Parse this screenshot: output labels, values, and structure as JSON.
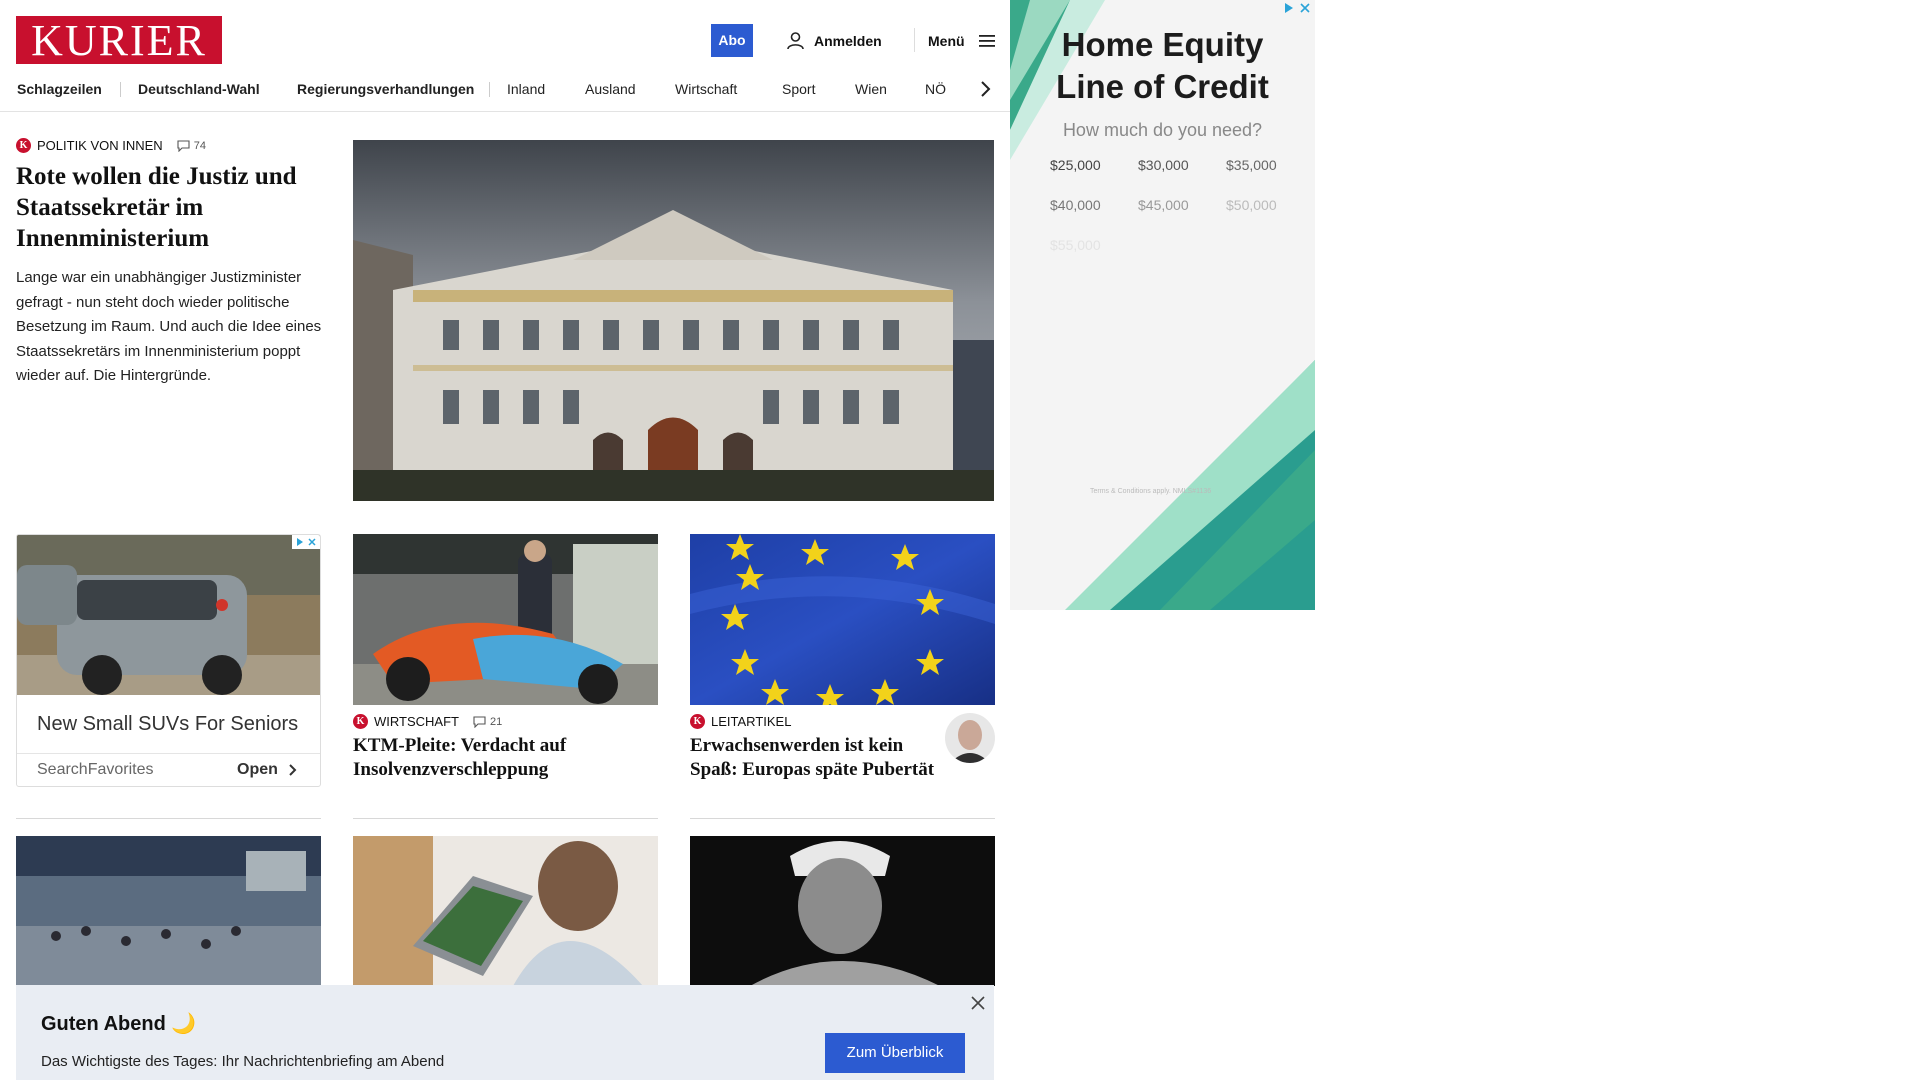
{
  "header": {
    "logo": "KURIER",
    "abo_label": "Abo",
    "login_label": "Anmelden",
    "menu_label": "Menü"
  },
  "nav": {
    "items": [
      "Schlagzeilen",
      "Deutschland-Wahl",
      "Regierungsverhandlungen",
      "Inland",
      "Ausland",
      "Wirtschaft",
      "Sport",
      "Wien",
      "NÖ"
    ]
  },
  "lead": {
    "category": "Politik von innen",
    "comments": "74",
    "title": "Rote wollen die Justiz und Staatssekretär im Innenministerium",
    "teaser": "Lange war ein unabhängiger Justizminister gefragt - nun steht doch wieder politische Besetzung im Raum. Und auch die Idee eines Staatssekretärs im Innenministerium poppt wieder auf. Die Hintergründe."
  },
  "inline_ad": {
    "title": "New Small SUVs For Seniors",
    "source": "SearchFavorites",
    "open_label": "Open"
  },
  "cards": [
    {
      "category": "Wirtschaft",
      "comments": "21",
      "title": "KTM-Pleite: Verdacht auf Insolvenzverschleppung"
    },
    {
      "category": "Leitartikel",
      "title": "Erwachsenwerden ist kein Spaß: Europas späte Pubertät"
    }
  ],
  "side_ad": {
    "title_line1": "Home Equity",
    "title_line2": "Line of Credit",
    "question": "How much do you need?",
    "amounts": [
      "$25,000",
      "$30,000",
      "$35,000",
      "$40,000",
      "$45,000",
      "$50,000",
      "$55,000"
    ],
    "terms": "Terms & Conditions apply. NMLS#1136"
  },
  "banner": {
    "title": "Guten Abend 🌙",
    "text": "Das Wichtigste des Tages: Ihr Nachrichtenbriefing am Abend",
    "cta_label": "Zum Überblick"
  },
  "colors": {
    "brand_red": "#c8102e",
    "accent_blue": "#2c5bd1",
    "ad_teal": "#2a9d8f"
  }
}
